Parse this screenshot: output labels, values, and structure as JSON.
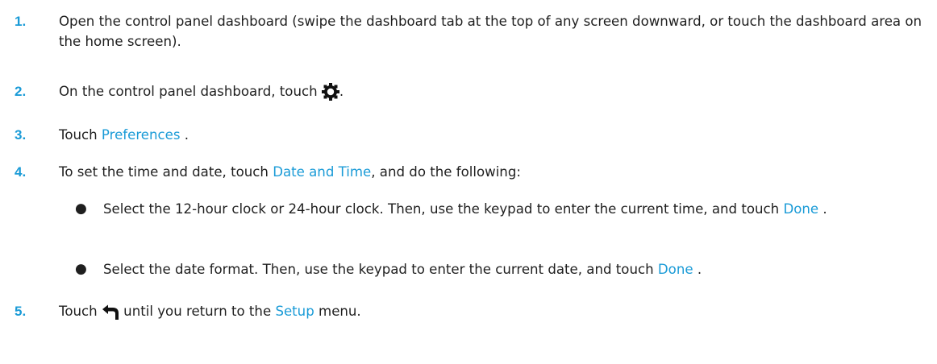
{
  "steps": [
    {
      "number": "1.",
      "text": "Open the control panel dashboard (swipe the dashboard tab at the top of any screen downward, or touch the dashboard area on the home screen)."
    },
    {
      "number": "2.",
      "text_before": "On the control panel dashboard, touch",
      "icon": "gear-icon",
      "text_after": "."
    },
    {
      "number": "3.",
      "text_before": "Touch ",
      "link": "Preferences",
      "text_after": " ."
    },
    {
      "number": "4.",
      "text_before": "To set the time and date, touch ",
      "link": "Date and Time",
      "text_after": ", and do the following:",
      "bullets": [
        {
          "symbol": "●",
          "text_before": "Select the 12-hour clock or 24-hour clock. Then, use the keypad to enter the current time, and touch ",
          "link": "Done",
          "text_after": " ."
        },
        {
          "symbol": "●",
          "text_before": "Select the date format. Then, use the keypad to enter the current date, and touch ",
          "link": "Done",
          "text_after": " ."
        }
      ]
    },
    {
      "number": "5.",
      "text_before": "Touch ",
      "icon": "back-arrow-icon",
      "text_middle": " until you return to the ",
      "link": "Setup",
      "text_after": " menu."
    }
  ],
  "colors": {
    "accent": "#1a9bd7",
    "text": "#1f1f1f"
  }
}
